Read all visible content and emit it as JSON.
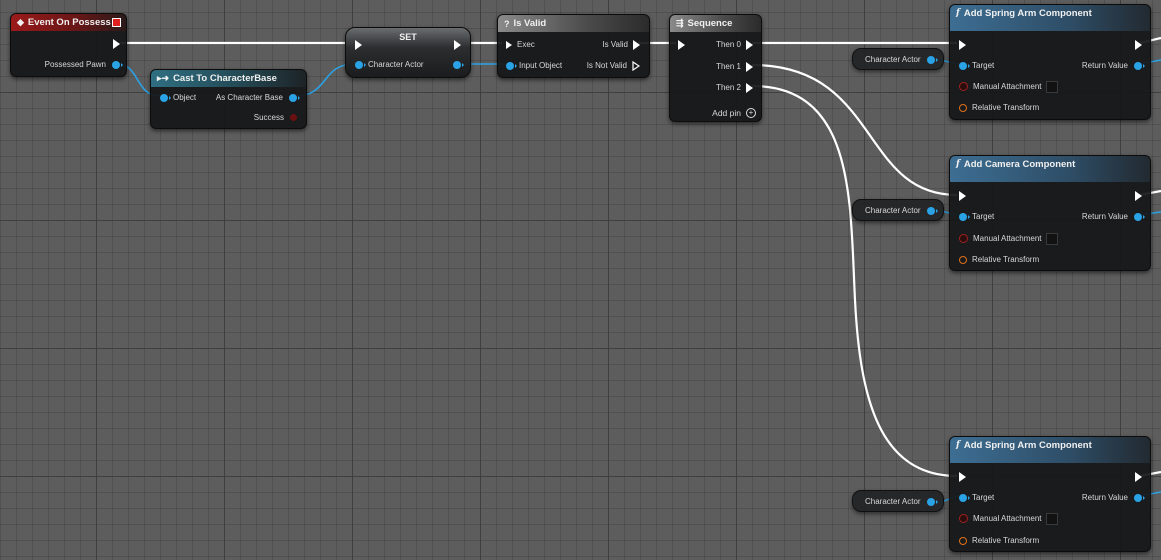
{
  "event_node": {
    "title": "Event On Possess",
    "pin_possessed_pawn": "Possessed Pawn"
  },
  "cast_node": {
    "title": "Cast To CharacterBase",
    "pin_object": "Object",
    "pin_as_character_base": "As Character Base",
    "pin_success": "Success"
  },
  "set_node": {
    "title": "SET",
    "pin_character_actor": "Character Actor"
  },
  "isvalid_node": {
    "icon": "?",
    "title": "Is Valid",
    "pin_exec": "Exec",
    "pin_input_object": "Input Object",
    "pin_is_valid": "Is Valid",
    "pin_is_not_valid": "Is Not Valid"
  },
  "sequence_node": {
    "title": "Sequence",
    "then0": "Then 0",
    "then1": "Then 1",
    "then2": "Then 2",
    "add_pin": "Add pin"
  },
  "func_nodes": [
    {
      "icon": "f",
      "title": "Add Spring Arm Component",
      "target": "Target",
      "return_value": "Return Value",
      "manual_attachment": "Manual Attachment",
      "relative_transform": "Relative Transform"
    },
    {
      "icon": "f",
      "title": "Add Camera Component",
      "target": "Target",
      "return_value": "Return Value",
      "manual_attachment": "Manual Attachment",
      "relative_transform": "Relative Transform"
    },
    {
      "icon": "f",
      "title": "Add Spring Arm Component",
      "target": "Target",
      "return_value": "Return Value",
      "manual_attachment": "Manual Attachment",
      "relative_transform": "Relative Transform"
    }
  ],
  "variable_nodes": [
    {
      "label": "Character Actor"
    },
    {
      "label": "Character Actor"
    },
    {
      "label": "Character Actor"
    }
  ],
  "colors": {
    "exec_wire": "#ffffff",
    "object_wire": "#2aa3e6",
    "event_header": "#9b1a1a",
    "function_header": "#3d6e93",
    "cast_header": "#2f6f82"
  }
}
